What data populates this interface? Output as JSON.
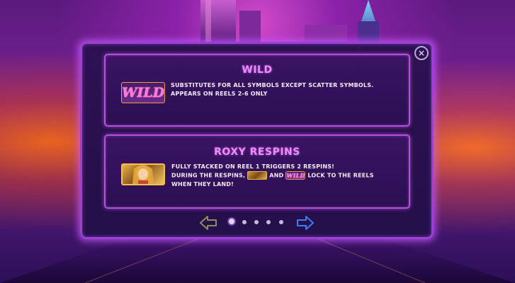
{
  "close_label": "×",
  "cards": {
    "wild": {
      "title": "WILD",
      "icon_text": "WILD",
      "line1": "SUBSTITUTES FOR ALL SYMBOLS EXCEPT SCATTER SYMBOLS.",
      "line2": "APPEARS ON REELS 2-6 ONLY"
    },
    "respin": {
      "title": "ROXY RESPINS",
      "line1": "FULLY STACKED ON REEL 1 TRIGGERS 2 RESPINS!",
      "line2_start": "DURING THE RESPINS,",
      "line2_and": "AND",
      "line2_wild_icon": "WILD",
      "line2_end": "LOCK  TO  THE REELS",
      "line3": "WHEN THEY  LAND!"
    }
  },
  "pagination": {
    "total_pages": 5,
    "current_page": 1
  },
  "icons": {
    "close": "close-icon",
    "prev": "arrow-left-icon",
    "next": "arrow-right-icon",
    "wild": "wild-symbol-icon",
    "roxy": "roxy-symbol-icon"
  },
  "colors": {
    "title": "#ec8bff",
    "frame": "#9b3fd6",
    "card_border": "#b94de0"
  }
}
